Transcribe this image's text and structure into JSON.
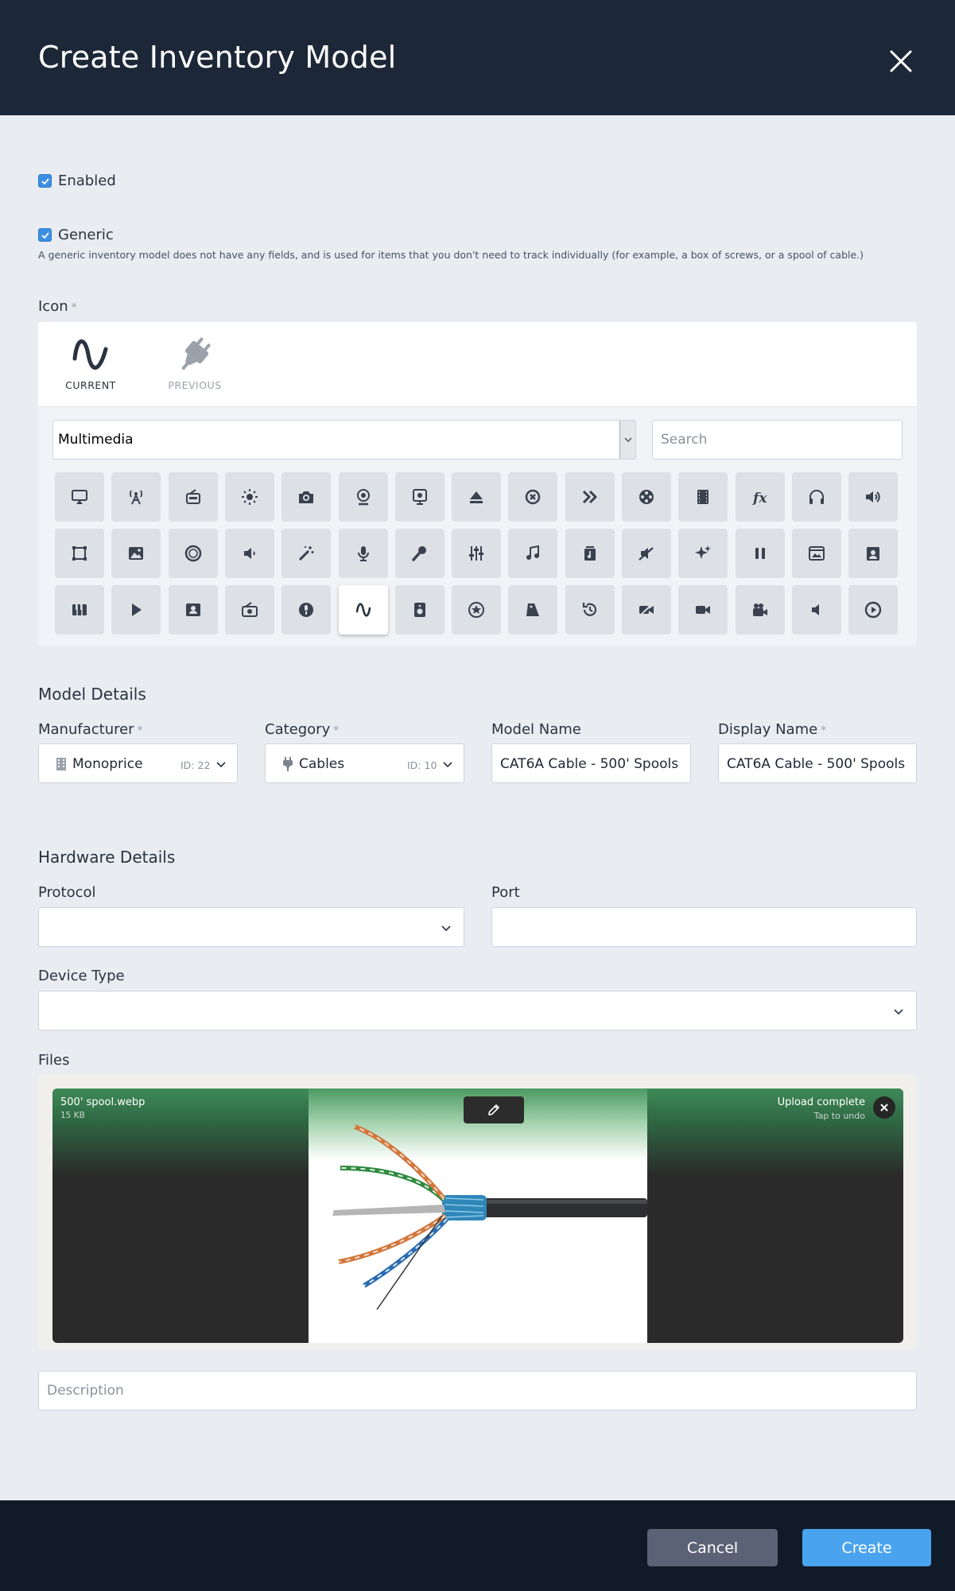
{
  "header": {
    "title": "Create Inventory Model"
  },
  "enabled": {
    "label": "Enabled",
    "checked": true
  },
  "generic": {
    "label": "Generic",
    "checked": true,
    "help": "A generic inventory model does not have any fields, and is used for items that you don't need to track individually (for example, a box of screws, or a spool of cable.)"
  },
  "icon": {
    "label": "Icon",
    "required_mark": "*",
    "current_label": "CURRENT",
    "previous_label": "PREVIOUS",
    "category": "Multimedia",
    "search_placeholder": "Search",
    "grid": [
      [
        "airplay-icon",
        "broadcast-tower-icon",
        "radio-icon",
        "brightness-icon",
        "camera-icon",
        "webcam-icon",
        "projector-icon",
        "eject-icon",
        "cancel-record-icon",
        "fast-forward-icon",
        "film-reel-icon",
        "film-icon",
        "function-icon",
        "headphones-icon",
        "volume-up-icon"
      ],
      [
        "crop-frame-icon",
        "image-icon",
        "vinyl-record-icon",
        "volume-low-icon",
        "magic-wand-icon",
        "microphone-icon",
        "karaoke-mic-icon",
        "sliders-icon",
        "music-note-icon",
        "music-album-icon",
        "mute-icon",
        "sparkles-icon",
        "pause-icon",
        "image-gallery-icon",
        "portrait-icon"
      ],
      [
        "piano-icon",
        "play-icon",
        "contact-card-icon",
        "radio-cassette-icon",
        "podcast-icon",
        "waveform-icon",
        "speaker-icon",
        "star-badge-icon",
        "tag-icon",
        "history-icon",
        "video-off-icon",
        "video-camera-icon",
        "film-camera-icon",
        "volume-off-icon",
        "play-circle-icon"
      ]
    ],
    "selected": "waveform-icon"
  },
  "model_details": {
    "title": "Model Details",
    "manufacturer": {
      "label": "Manufacturer",
      "value": "Monoprice",
      "id_text": "ID: 22"
    },
    "category": {
      "label": "Category",
      "value": "Cables",
      "id_text": "ID: 10"
    },
    "model_name": {
      "label": "Model Name",
      "value": "CAT6A Cable - 500' Spools"
    },
    "display_name": {
      "label": "Display Name",
      "value": "CAT6A Cable - 500' Spools"
    }
  },
  "hardware_details": {
    "title": "Hardware Details",
    "protocol": {
      "label": "Protocol",
      "value": ""
    },
    "port": {
      "label": "Port",
      "value": ""
    },
    "device_type": {
      "label": "Device Type",
      "value": ""
    }
  },
  "files": {
    "label": "Files",
    "file_name": "500' spool.webp",
    "file_size": "15 KB",
    "status": "Upload complete",
    "status_sub": "Tap to undo"
  },
  "description": {
    "placeholder": "Description"
  },
  "footer": {
    "cancel_label": "Cancel",
    "create_label": "Create"
  },
  "colors": {
    "header_bg": "#1c2838",
    "footer_bg": "#111a29",
    "accent": "#4aa3ee",
    "cancel_bg": "#5b6275",
    "checkbox": "#3d8fe0"
  }
}
